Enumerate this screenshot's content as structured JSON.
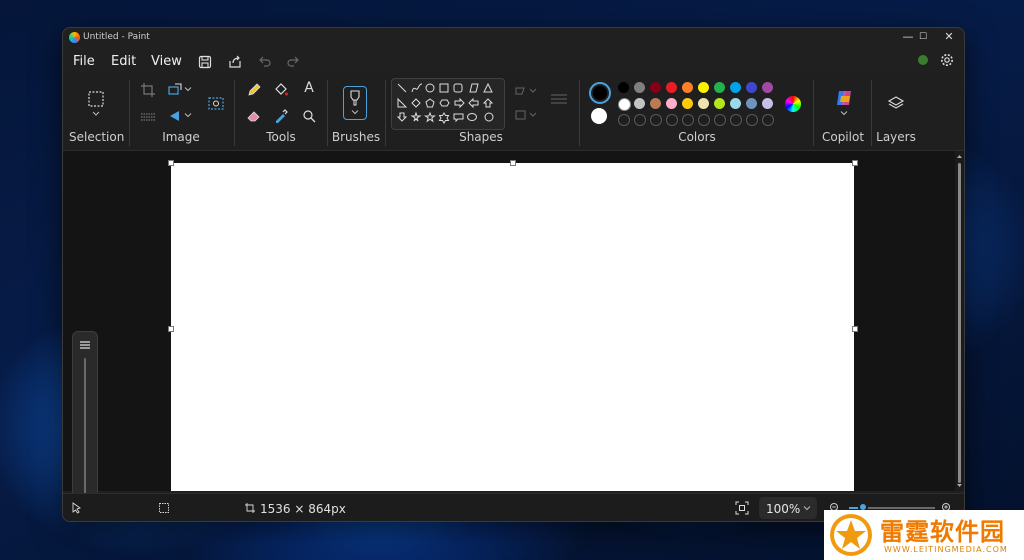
{
  "window": {
    "title": "Untitled - Paint"
  },
  "window_controls": {
    "minimize": "—",
    "maximize": "☐",
    "close": "✕"
  },
  "menu": {
    "file": "File",
    "edit": "Edit",
    "view": "View"
  },
  "ribbon": {
    "groups": {
      "selection": "Selection",
      "image": "Image",
      "tools": "Tools",
      "brushes": "Brushes",
      "shapes": "Shapes",
      "colors": "Colors",
      "copilot": "Copilot",
      "layers": "Layers"
    },
    "text_tool": "A"
  },
  "colors": {
    "primary": "#000000",
    "secondary": "#ffffff",
    "palette_row1": [
      "#000000",
      "#7f7f7f",
      "#880015",
      "#ed1c24",
      "#ff7f27",
      "#fff200",
      "#22b14c",
      "#00a2e8",
      "#3f48cc",
      "#a349a4"
    ],
    "palette_row2": [
      "#ffffff",
      "#c3c3c3",
      "#b97a57",
      "#ffaec9",
      "#ffc90e",
      "#efe4b0",
      "#b5e61d",
      "#99d9ea",
      "#7092be",
      "#c8bfe7"
    ],
    "status_dot": "#3b7d2f"
  },
  "status": {
    "canvas_size": "1536 × 864px",
    "zoom": "100%"
  },
  "watermark": {
    "name": "雷霆软件园",
    "url": "WWW.LEITINGMEDIA.COM"
  }
}
